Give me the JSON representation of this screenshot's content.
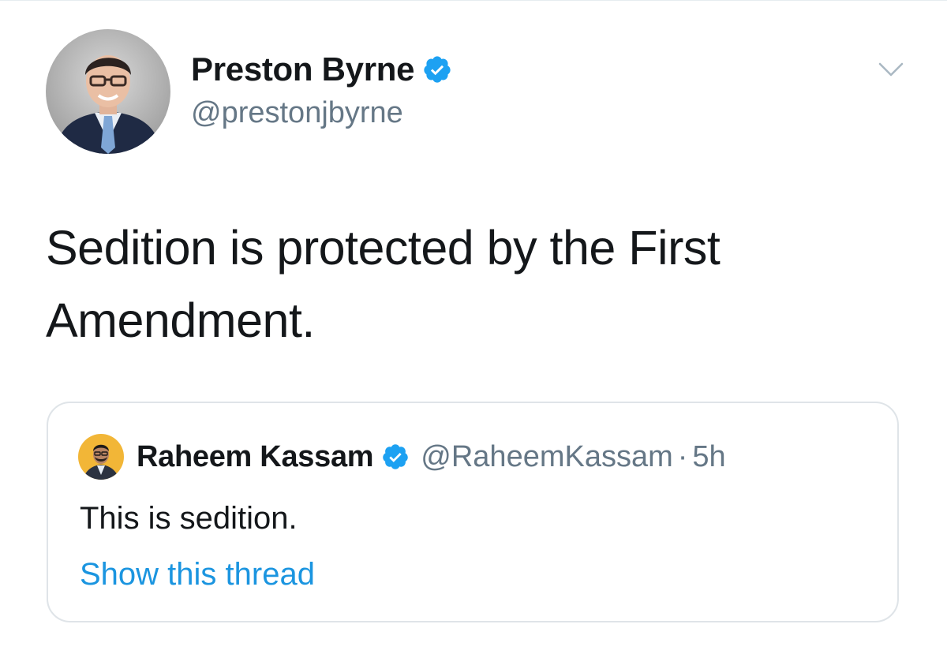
{
  "tweet": {
    "author": {
      "display_name": "Preston Byrne",
      "handle": "@prestonjbyrne",
      "verified": true,
      "avatar_icon": "user-photo-avatar"
    },
    "text": "Sedition is protected by the First Amendment.",
    "menu_icon": "chevron-down-icon"
  },
  "quoted_tweet": {
    "author": {
      "display_name": "Raheem Kassam",
      "handle": "@RaheemKassam",
      "verified": true,
      "avatar_icon": "user-photo-avatar"
    },
    "separator": "·",
    "time": "5h",
    "text": "This is sedition.",
    "show_thread_label": "Show this thread"
  },
  "colors": {
    "text_primary": "#14171a",
    "text_secondary": "#657786",
    "link": "#1b95e0",
    "verified": "#1da1f2",
    "card_border": "#dfe4e8"
  }
}
